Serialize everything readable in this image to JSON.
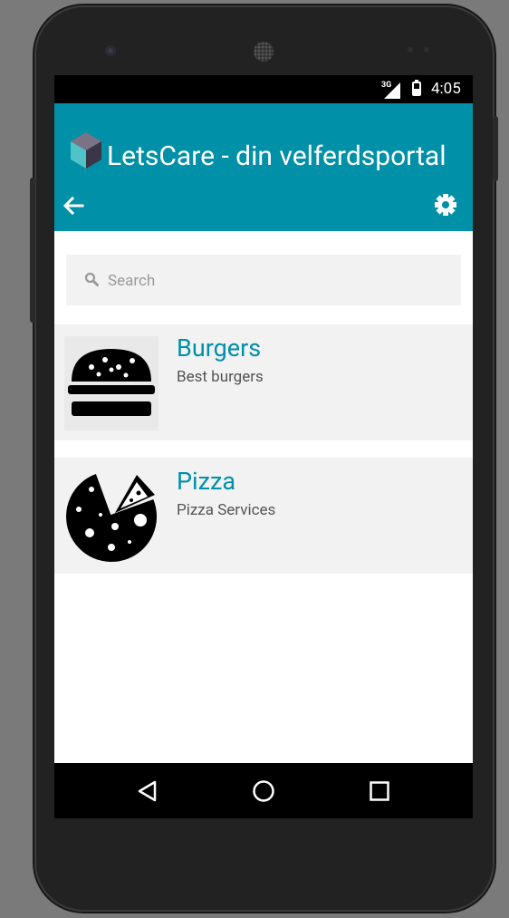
{
  "statusbar": {
    "network": "3G",
    "time": "4:05"
  },
  "appbar": {
    "title": "LetsCare - din velferdsportal",
    "back_icon": "arrow-back-icon",
    "settings_icon": "gear-icon"
  },
  "search": {
    "placeholder": "Search",
    "value": ""
  },
  "items": [
    {
      "title": "Burgers",
      "subtitle": "Best burgers",
      "icon": "burger-icon"
    },
    {
      "title": "Pizza",
      "subtitle": "Pizza Services",
      "icon": "pizza-icon"
    }
  ],
  "navbar": {
    "back": "nav-back-icon",
    "home": "nav-home-icon",
    "recents": "nav-recents-icon"
  },
  "colors": {
    "accent": "#0090a8",
    "item_bg": "#f2f2f2",
    "search_bg": "#f2f2f2"
  }
}
